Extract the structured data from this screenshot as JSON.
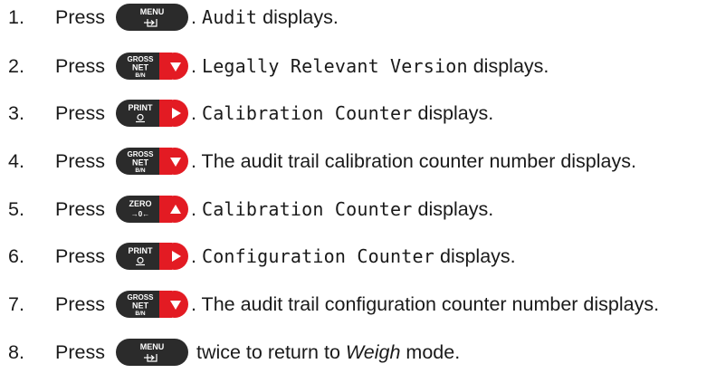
{
  "steps": [
    {
      "num": "1.",
      "press": "Press",
      "button": {
        "type": "menu",
        "top": "MENU",
        "icon": "exit-arrow-icon"
      },
      "segments": [
        {
          "text": ". ",
          "mono": false
        },
        {
          "text": "Audit",
          "mono": true
        },
        {
          "text": " displays.",
          "mono": false
        }
      ]
    },
    {
      "num": "2.",
      "press": "Press",
      "button": {
        "type": "gross",
        "line1": "GROSS",
        "line2": "NET",
        "line3": "B/N",
        "arrow": "down",
        "color": "#e31b23"
      },
      "segments": [
        {
          "text": ". ",
          "mono": false
        },
        {
          "text": "Legally Relevant Version",
          "mono": true
        },
        {
          "text": " displays.",
          "mono": false
        }
      ]
    },
    {
      "num": "3.",
      "press": "Press",
      "button": {
        "type": "print",
        "top": "PRINT",
        "icon": "print-icon",
        "arrow": "right",
        "color": "#e31b23"
      },
      "segments": [
        {
          "text": ". ",
          "mono": false
        },
        {
          "text": "Calibration Counter",
          "mono": true
        },
        {
          "text": " displays.",
          "mono": false
        }
      ]
    },
    {
      "num": "4.",
      "press": "Press",
      "button": {
        "type": "gross",
        "line1": "GROSS",
        "line2": "NET",
        "line3": "B/N",
        "arrow": "down",
        "color": "#e31b23"
      },
      "segments": [
        {
          "text": ". The audit trail calibration counter number displays.",
          "mono": false
        }
      ]
    },
    {
      "num": "5.",
      "press": "Press",
      "button": {
        "type": "zero",
        "top": "ZERO",
        "sub": "→0←",
        "arrow": "up",
        "color": "#e31b23"
      },
      "segments": [
        {
          "text": ". ",
          "mono": false
        },
        {
          "text": "Calibration Counter",
          "mono": true
        },
        {
          "text": " displays.",
          "mono": false
        }
      ]
    },
    {
      "num": "6.",
      "press": "Press",
      "button": {
        "type": "print",
        "top": "PRINT",
        "icon": "print-icon",
        "arrow": "right",
        "color": "#e31b23"
      },
      "segments": [
        {
          "text": ". ",
          "mono": false
        },
        {
          "text": "Configuration Counter",
          "mono": true
        },
        {
          "text": " displays.",
          "mono": false
        }
      ]
    },
    {
      "num": "7.",
      "press": "Press",
      "button": {
        "type": "gross",
        "line1": "GROSS",
        "line2": "NET",
        "line3": "B/N",
        "arrow": "down",
        "color": "#e31b23"
      },
      "segments": [
        {
          "text": ". The audit trail configuration counter number displays.",
          "mono": false
        }
      ]
    },
    {
      "num": "8.",
      "press": "Press",
      "button": {
        "type": "menu",
        "top": "MENU",
        "icon": "exit-arrow-icon"
      },
      "segments": [
        {
          "text": " twice to return to ",
          "mono": false
        },
        {
          "text": "Weigh",
          "mono": false,
          "italic": true
        },
        {
          "text": " mode.",
          "mono": false
        }
      ]
    }
  ]
}
